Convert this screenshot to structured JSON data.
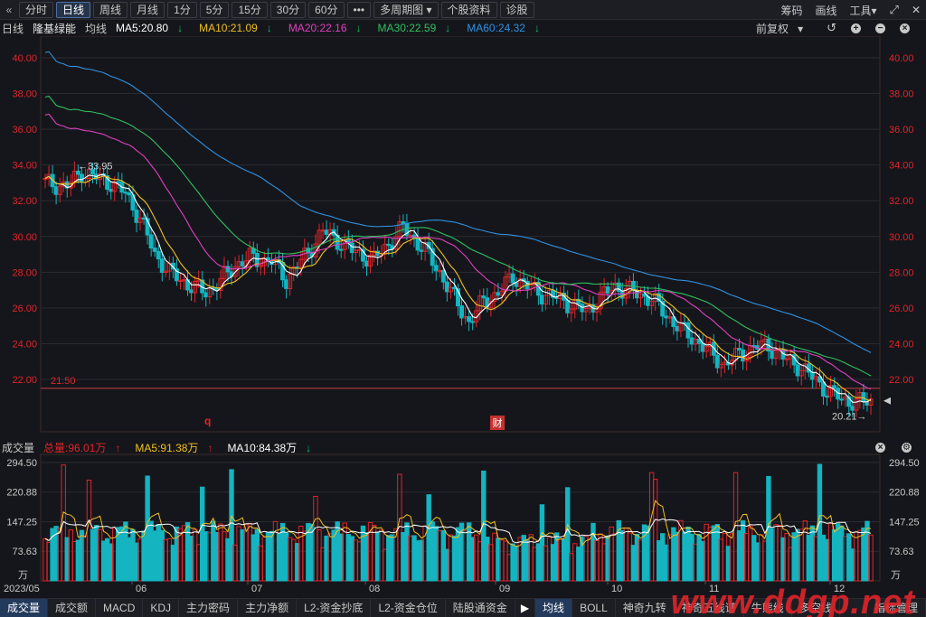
{
  "toolbar": {
    "collapse_icon": "double-chevron-left-icon",
    "periods": [
      "分时",
      "日线",
      "周线",
      "月线",
      "1分",
      "5分",
      "15分",
      "30分",
      "60分"
    ],
    "active_period": "日线",
    "more_label": "•••",
    "multi_period": "多周期图",
    "stock_info": "个股资料",
    "diagnose": "诊股",
    "chips": "筹码",
    "draw_line": "画线",
    "tools": "工具",
    "dropdown_glyph": "▾",
    "fullscreen_icon": "fullscreen-icon",
    "close_glyph": "✕"
  },
  "info": {
    "period": "日线",
    "stock_name": "隆基绿能",
    "ma_label": "均线",
    "ma5": "MA5:20.80",
    "ma10": "MA10:21.09",
    "ma20": "MA20:22.16",
    "ma30": "MA30:22.59",
    "ma60": "MA60:24.32",
    "down_arrow": "↓",
    "adjust": "前复权",
    "adjust_arrow": "▾",
    "ctrl_minus": "−",
    "ctrl_plus": "+"
  },
  "colors": {
    "up": "#e0242a",
    "down": "#14b4c0",
    "ma5": "#ffffff",
    "ma10": "#f0c020",
    "ma20": "#e040c0",
    "ma30": "#30c060",
    "ma60": "#3090e0"
  },
  "price_axis": {
    "ticks": [
      "40.00",
      "38.00",
      "36.00",
      "34.00",
      "32.00",
      "30.00",
      "28.00",
      "26.00",
      "24.00",
      "22.00"
    ]
  },
  "annotations": {
    "high": "←33.95",
    "low": "20.21→",
    "ref_line": "21.50",
    "marker_q": "q",
    "marker_cai": "财"
  },
  "volume": {
    "title": "成交量",
    "total": "总量:96.01万",
    "ma5": "MA5:91.38万",
    "ma10": "MA10:84.38万",
    "up_arrow": "↑",
    "down_arrow": "↓",
    "ticks": [
      "294.50",
      "220.88",
      "147.25",
      "73.63"
    ],
    "unit": "万"
  },
  "date_axis": {
    "labels": [
      "2023/05",
      "06",
      "07",
      "08",
      "09",
      "10",
      "11",
      "12"
    ]
  },
  "bottom_tabs": {
    "left": [
      "成交量",
      "成交额",
      "MACD",
      "KDJ",
      "主力密码",
      "主力净额",
      "L2-资金抄底",
      "L2-资金仓位",
      "陆股通资金"
    ],
    "active_left": "成交量",
    "right": [
      "均线",
      "BOLL",
      "神奇九转",
      "神奇五线谱",
      "牛熊线",
      "多空线",
      "指标管理"
    ],
    "active_right": "均线",
    "tri_glyph": "▶"
  },
  "watermark": "www.ddgp.net",
  "chart_data": {
    "type": "candlestick",
    "ylim": [
      20,
      41
    ],
    "ma_values": {
      "MA5": 20.8,
      "MA10": 21.09,
      "MA20": 22.16,
      "MA30": 22.59,
      "MA60": 24.32
    },
    "high": 33.95,
    "low": 20.21,
    "reference_line": 21.5,
    "volume_ylim": [
      0,
      320
    ],
    "volume_total_wan": 96.01,
    "volume_ma5_wan": 91.38,
    "volume_ma10_wan": 84.38
  }
}
